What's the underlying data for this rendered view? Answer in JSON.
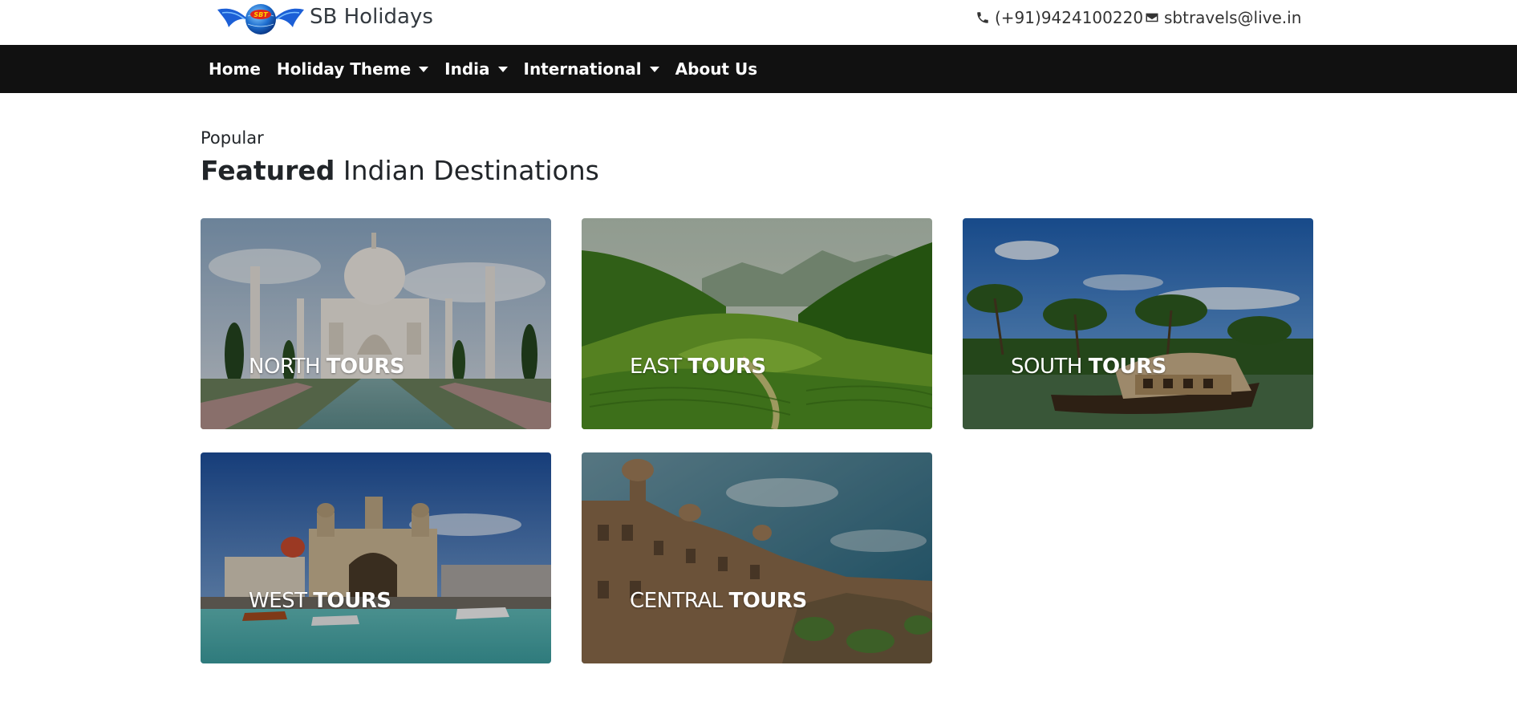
{
  "header": {
    "brand": "SB Holidays",
    "logo_text": "SBT",
    "phone": "(+91)9424100220",
    "email": "sbtravels@live.in"
  },
  "nav": {
    "items": [
      {
        "label": "Home",
        "dropdown": false
      },
      {
        "label": "Holiday Theme",
        "dropdown": true
      },
      {
        "label": "India",
        "dropdown": true
      },
      {
        "label": "International",
        "dropdown": true
      },
      {
        "label": "About Us",
        "dropdown": false
      }
    ]
  },
  "section": {
    "eyebrow": "Popular",
    "heading_bold": "Featured",
    "heading_rest": " Indian Destinations"
  },
  "cards": [
    {
      "region": "NORTH",
      "suffix": "TOURS"
    },
    {
      "region": "EAST",
      "suffix": "TOURS"
    },
    {
      "region": "SOUTH",
      "suffix": "TOURS"
    },
    {
      "region": "WEST",
      "suffix": "TOURS"
    },
    {
      "region": "CENTRAL",
      "suffix": "TOURS"
    }
  ],
  "colors": {
    "navbar": "#111111",
    "text": "#212529"
  },
  "icons": [
    "logo-icon",
    "phone-icon",
    "envelope-icon",
    "caret-down-icon"
  ]
}
